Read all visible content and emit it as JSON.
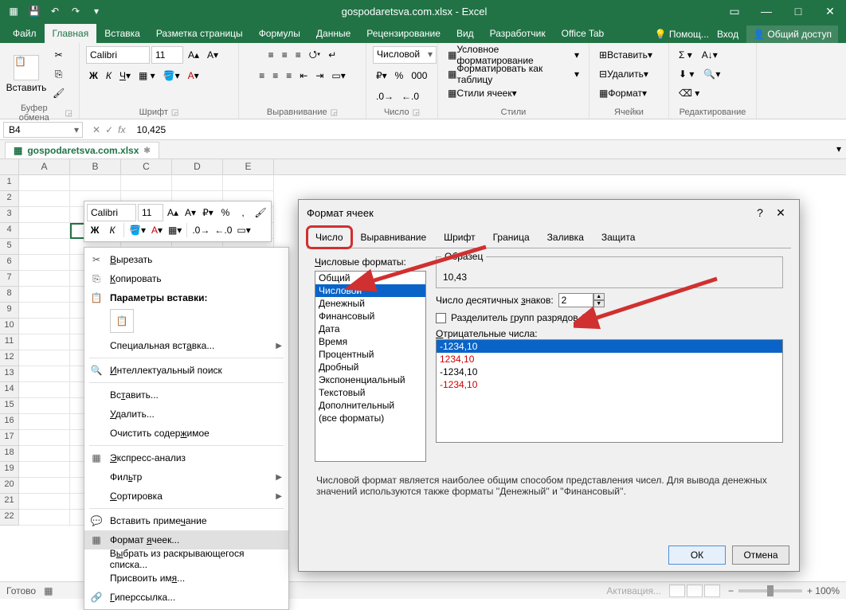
{
  "titlebar": {
    "title": "gospodaretsva.com.xlsx - Excel"
  },
  "menutabs": {
    "file": "Файл",
    "tabs": [
      "Главная",
      "Вставка",
      "Разметка страницы",
      "Формулы",
      "Данные",
      "Рецензирование",
      "Вид",
      "Разработчик",
      "Office Tab"
    ],
    "active": 0,
    "tell": "Помощ...",
    "signin": "Вход",
    "share": "Общий доступ"
  },
  "ribbon": {
    "clipboard": {
      "paste": "Вставить",
      "label": "Буфер обмена"
    },
    "font": {
      "name": "Calibri",
      "size": "11",
      "label": "Шрифт"
    },
    "align": {
      "label": "Выравнивание"
    },
    "number": {
      "fmt": "Числовой",
      "label": "Число"
    },
    "styles": {
      "cond": "Условное форматирование",
      "table": "Форматировать как таблицу",
      "cell": "Стили ячеек",
      "label": "Стили"
    },
    "cells": {
      "insert": "Вставить",
      "delete": "Удалить",
      "format": "Формат",
      "label": "Ячейки"
    },
    "editing": {
      "label": "Редактирование"
    }
  },
  "namebox": "B4",
  "formula": "10,425",
  "filetab": "gospodaretsva.com.xlsx",
  "cols": [
    "A",
    "B",
    "C",
    "D",
    "E"
  ],
  "rowcount": 22,
  "minitb": {
    "font": "Calibri",
    "size": "11"
  },
  "ctx": {
    "cut": "Вырезать",
    "copy": "Копировать",
    "pasteSection": "Параметры вставки:",
    "pasteSpecial": "Специальная вставка...",
    "smartLookup": "Интеллектуальный поиск",
    "insert": "Вставить...",
    "delete": "Удалить...",
    "clear": "Очистить содержимое",
    "quick": "Экспресс-анализ",
    "filter": "Фильтр",
    "sort": "Сортировка",
    "comment": "Вставить примечание",
    "format": "Формат ячеек...",
    "pick": "Выбрать из раскрывающегося списка...",
    "defname": "Присвоить имя...",
    "link": "Гиперссылка..."
  },
  "dialog": {
    "title": "Формат ячеек",
    "tabs": [
      "Число",
      "Выравнивание",
      "Шрифт",
      "Граница",
      "Заливка",
      "Защита"
    ],
    "activeTab": 0,
    "catLabel": "Числовые форматы:",
    "categories": [
      "Общий",
      "Числовой",
      "Денежный",
      "Финансовый",
      "Дата",
      "Время",
      "Процентный",
      "Дробный",
      "Экспоненциальный",
      "Текстовый",
      "Дополнительный",
      "(все форматы)"
    ],
    "selectedCat": 1,
    "sampleLabel": "Образец",
    "sampleValue": "10,43",
    "decLabel": "Число десятичных знаков:",
    "decValue": "2",
    "sepLabel": "Разделитель групп разрядов ( )",
    "negLabel": "Отрицательные числа:",
    "negs": [
      "-1234,10",
      "1234,10",
      "-1234,10",
      "-1234,10"
    ],
    "negColors": [
      "white",
      "red",
      "black",
      "red"
    ],
    "negSel": 0,
    "desc": "Числовой формат является наиболее общим способом представления чисел. Для вывода денежных значений используются также форматы ''Денежный'' и ''Финансовый''.",
    "ok": "ОК",
    "cancel": "Отмена"
  },
  "status": {
    "ready": "Готово",
    "activation": "Активация...",
    "zoom": "+ 100%"
  }
}
